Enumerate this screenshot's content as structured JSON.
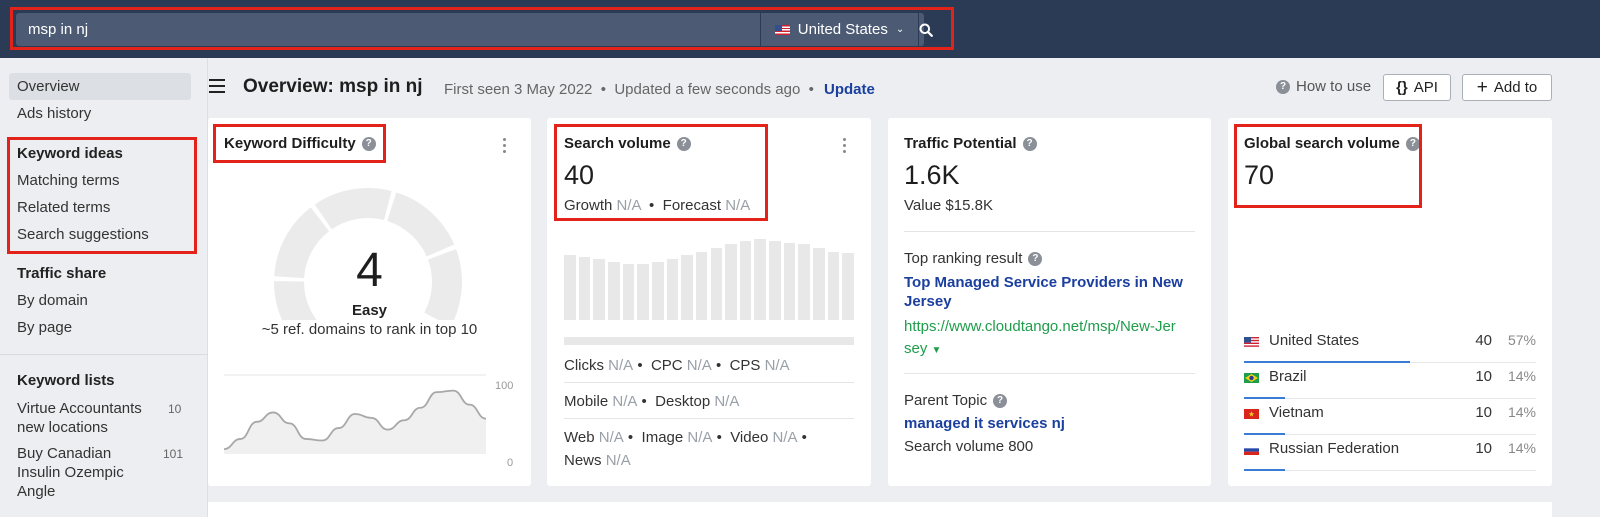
{
  "search": {
    "query": "msp in nj",
    "country": "United States"
  },
  "sidebar": {
    "overview": "Overview",
    "ads_history": "Ads history",
    "keyword_ideas": "Keyword ideas",
    "matching_terms": "Matching terms",
    "related_terms": "Related terms",
    "search_suggestions": "Search suggestions",
    "traffic_share": "Traffic share",
    "by_domain": "By domain",
    "by_page": "By page",
    "keyword_lists": "Keyword lists",
    "lists": [
      {
        "name_line1": "Virtue Accountants",
        "name_line2": "new locations",
        "count": "10"
      },
      {
        "name_line1": "Buy Canadian",
        "name_line2": "Insulin Ozempic",
        "name_line3": "Angle",
        "count": "101"
      }
    ]
  },
  "header": {
    "title": "Overview: msp in nj",
    "first_seen": "First seen 3 May 2022",
    "updated": "Updated a few seconds ago",
    "update_link": "Update",
    "how_to_use": "How to use",
    "api_label": "API",
    "api_glyph": "{}",
    "add_to_label": "Add to"
  },
  "kd": {
    "title": "Keyword Difficulty",
    "value": "4",
    "fraction": 0.04,
    "label": "Easy",
    "ref_text": "~5 ref. domains to rank in top 10",
    "axis_top": "100",
    "axis_bottom": "0",
    "trend": [
      5,
      18,
      40,
      52,
      38,
      18,
      16,
      32,
      50,
      45,
      30,
      42,
      58,
      78,
      80,
      62,
      44
    ]
  },
  "sv": {
    "title": "Search volume",
    "value": "40",
    "growth_label": "Growth",
    "forecast_label": "Forecast",
    "na": "N/A",
    "bars": [
      72,
      70,
      68,
      65,
      62,
      62,
      64,
      68,
      72,
      76,
      80,
      84,
      88,
      90,
      88,
      86,
      84,
      80,
      76,
      74
    ],
    "row1": {
      "clicks": "Clicks",
      "cpc": "CPC",
      "cps": "CPS"
    },
    "row2": {
      "mobile": "Mobile",
      "desktop": "Desktop"
    },
    "row3": {
      "web": "Web",
      "image": "Image",
      "video": "Video",
      "news": "News"
    }
  },
  "tp": {
    "title": "Traffic Potential",
    "value": "1.6K",
    "value_text": "Value $15.8K",
    "top_result_label": "Top ranking result",
    "top_result_title_1": "Top Managed Service Providers in New",
    "top_result_title_2": "Jersey",
    "top_result_url_1": "https://www.cloudtango.net/msp/New-Jer",
    "top_result_url_2": "sey",
    "parent_topic_label": "Parent Topic",
    "parent_topic": "managed it services nj",
    "parent_volume": "Search volume 800"
  },
  "gsv": {
    "title": "Global search volume",
    "value": "70",
    "countries": [
      {
        "name": "United States",
        "value": "40",
        "pct": "57%",
        "fill": 0.57,
        "flag": "us"
      },
      {
        "name": "Brazil",
        "value": "10",
        "pct": "14%",
        "fill": 0.14,
        "flag": "br"
      },
      {
        "name": "Vietnam",
        "value": "10",
        "pct": "14%",
        "fill": 0.14,
        "flag": "vn"
      },
      {
        "name": "Russian Federation",
        "value": "10",
        "pct": "14%",
        "fill": 0.14,
        "flag": "ru"
      }
    ]
  }
}
